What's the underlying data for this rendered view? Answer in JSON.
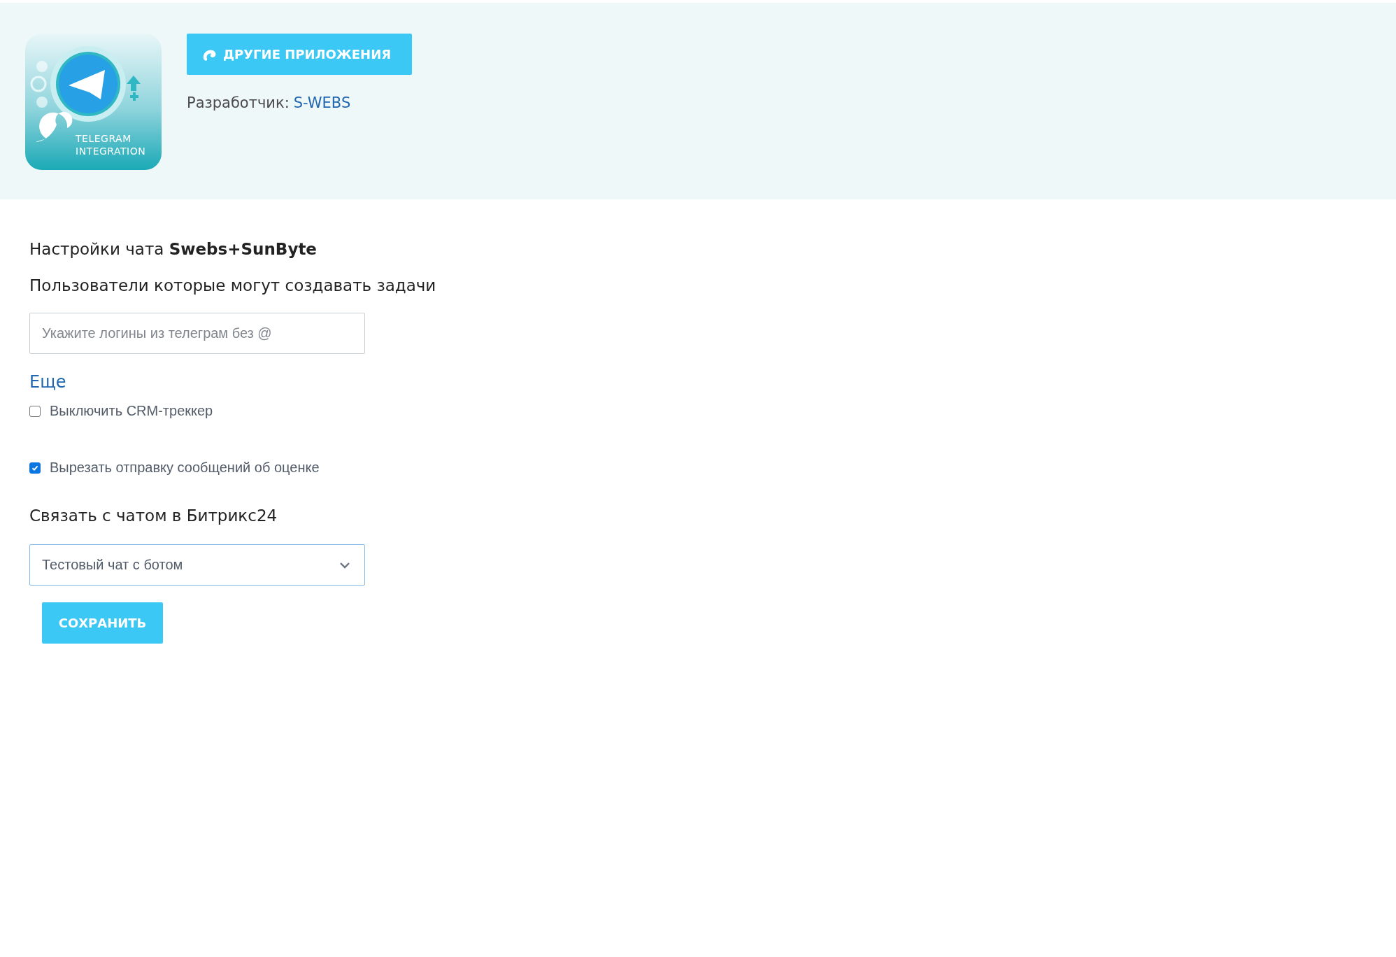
{
  "header": {
    "logo": {
      "lines": [
        "TELEGRAM",
        "INTEGRATION"
      ]
    },
    "other_apps_button": "ДРУГИЕ ПРИЛОЖЕНИЯ",
    "developer": {
      "label": "Разработчик:",
      "link": "S-WEBS"
    }
  },
  "form": {
    "title": "Настройки чата **Swebs+SunByte**",
    "users_label": "Пользователи которые могут создавать задачи",
    "users_field": {
      "placeholder": "Укажите логины из телеграм без @"
    },
    "more_link": "Еще",
    "options": [
      {
        "label": "Выключить CRM-треккер",
        "checked": false
      },
      {
        "label": "Вырезать отправку сообщений об оценке",
        "checked": true
      }
    ],
    "chat_label": "Связать с чатом в Битрикс24",
    "chat_select": {
      "value": "Тестовый чат с ботом"
    },
    "save_button": "СОХРАНИТЬ"
  }
}
